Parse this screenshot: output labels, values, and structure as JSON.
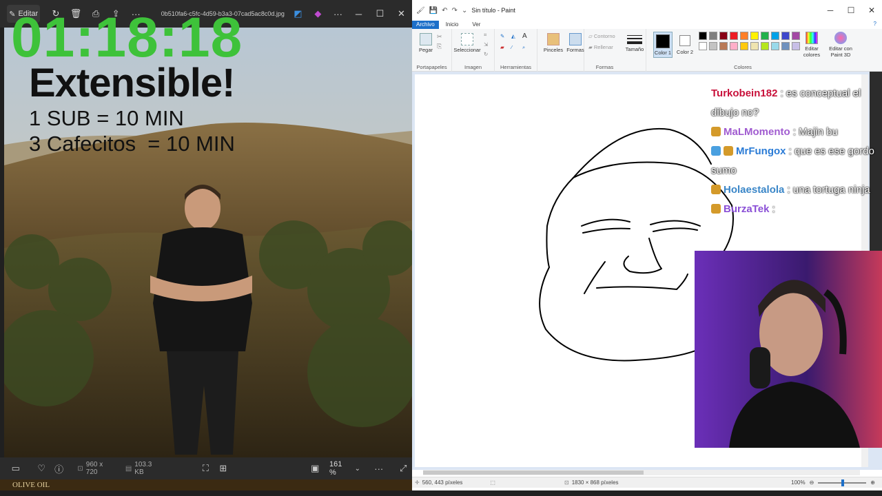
{
  "viewer": {
    "edit_label": "Editar",
    "filename": "0b510fa6-c5fc-4d59-b3a3-07cad5ac8c0d.jpg",
    "dimensions": "960 x 720",
    "filesize": "103.3 KB",
    "zoom": "161 %",
    "bottom_text": "OLIVE OIL"
  },
  "overlay": {
    "timer": "01:18:18",
    "headline": "Extensible!",
    "line1": "1 SUB = 10 MIN",
    "line2": "3 Cafecitos  = 10 MIN"
  },
  "paint": {
    "title": "Sin título - Paint",
    "tabs": [
      "Archivo",
      "Inicio",
      "Ver"
    ],
    "groups": {
      "portapapeles": "Portapapeles",
      "imagen": "Imagen",
      "herramientas": "Herramientas",
      "formas": "Formas",
      "colores": "Colores"
    },
    "buttons": {
      "pegar": "Pegar",
      "seleccionar": "Seleccionar",
      "pinceles": "Pinceles",
      "formas": "Formas",
      "contorno": "Contorno",
      "rellenar": "Rellenar",
      "tamano": "Tamaño",
      "color1": "Color 1",
      "color2": "Color 2",
      "editar_colores": "Editar colores",
      "editar_paint3d": "Editar con Paint 3D"
    },
    "palette": [
      "#000000",
      "#7f7f7f",
      "#880015",
      "#ed1c24",
      "#ff7f27",
      "#fff200",
      "#22b14c",
      "#00a2e8",
      "#3f48cc",
      "#a349a4",
      "#ffffff",
      "#c3c3c3",
      "#b97a57",
      "#ffaec9",
      "#ffc90e",
      "#efe4b0",
      "#b5e61d",
      "#99d9ea",
      "#7092be",
      "#c8bfe7"
    ],
    "status": {
      "cursor": "560, 443 píxeles",
      "size": "1830 × 868 píxeles",
      "zoom": "100%"
    }
  },
  "chat": [
    {
      "user": "Turkobein182",
      "message": ": es conceptual el dibujo no?"
    },
    {
      "user": "MaLMomento",
      "message": ": Majin bu"
    },
    {
      "user": "MrFungox",
      "message": ": que es ese gordo sumo"
    },
    {
      "user": "Holaestalola",
      "message": ": una tortuga ninja"
    },
    {
      "user": "BurzaTek",
      "message": ":"
    }
  ]
}
